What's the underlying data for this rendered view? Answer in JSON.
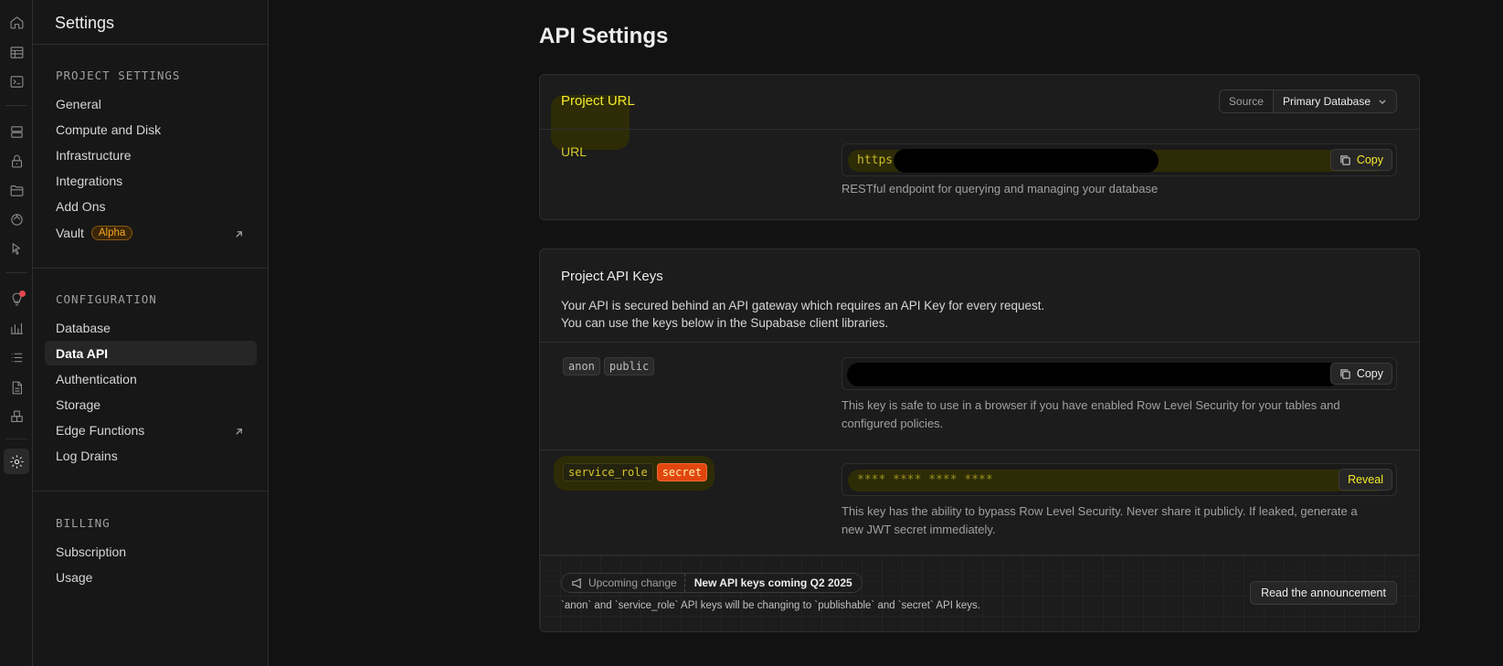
{
  "sidebar": {
    "title": "Settings",
    "sections": [
      {
        "heading": "PROJECT SETTINGS",
        "items": [
          {
            "label": "General"
          },
          {
            "label": "Compute and Disk"
          },
          {
            "label": "Infrastructure"
          },
          {
            "label": "Integrations"
          },
          {
            "label": "Add Ons"
          },
          {
            "label": "Vault",
            "badge": "Alpha",
            "external": true
          }
        ]
      },
      {
        "heading": "CONFIGURATION",
        "items": [
          {
            "label": "Database"
          },
          {
            "label": "Data API",
            "active": true
          },
          {
            "label": "Authentication"
          },
          {
            "label": "Storage"
          },
          {
            "label": "Edge Functions",
            "external": true
          },
          {
            "label": "Log Drains"
          }
        ]
      },
      {
        "heading": "BILLING",
        "items": [
          {
            "label": "Subscription"
          },
          {
            "label": "Usage"
          }
        ]
      }
    ]
  },
  "rail": {
    "icons": [
      "home-icon",
      "table-editor-icon",
      "sql-editor-icon",
      "database-icon",
      "auth-icon",
      "storage-icon",
      "realtime-icon",
      "edge-functions-icon",
      "advisors-icon",
      "reports-icon",
      "logs-icon",
      "api-docs-icon",
      "integrations-icon",
      "settings-icon"
    ]
  },
  "page": {
    "title": "API Settings"
  },
  "project_url": {
    "title": "Project URL",
    "source_label": "Source",
    "source_value": "Primary Database",
    "url_label": "URL",
    "url_value": "https",
    "copy_label": "Copy",
    "help": "RESTful endpoint for querying and managing your database"
  },
  "api_keys": {
    "title": "Project API Keys",
    "description_line1": "Your API is secured behind an API gateway which requires an API Key for every request.",
    "description_line2": "You can use the keys below in the Supabase client libraries.",
    "anon": {
      "tag1": "anon",
      "tag2": "public",
      "copy_label": "Copy",
      "help_line1": "This key is safe to use in a browser if you have enabled Row Level Security for your tables and",
      "help_line2": "configured policies."
    },
    "service": {
      "tag1": "service_role",
      "tag2": "secret",
      "masked_value": "**** **** **** ****",
      "reveal_label": "Reveal",
      "help_line1": "This key has the ability to bypass Row Level Security. Never share it publicly. If leaked, generate a",
      "help_line2": "new JWT secret immediately."
    },
    "announcement": {
      "upcoming_label": "Upcoming change",
      "upcoming_title": "New API keys coming Q2 2025",
      "note": "`anon` and `service_role` API keys will be changing to `publishable` and `secret` API keys.",
      "button_label": "Read the announcement"
    }
  }
}
